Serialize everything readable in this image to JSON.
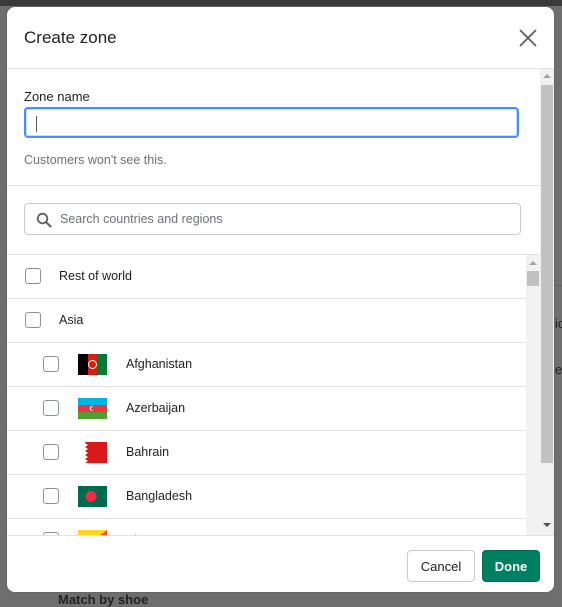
{
  "background": {
    "partial_texts": [
      "ic",
      "e",
      "Match by shoe"
    ]
  },
  "modal": {
    "title": "Create zone",
    "close_label": "Close"
  },
  "form": {
    "zone_name_label": "Zone name",
    "zone_name_value": "",
    "zone_name_help": "Customers won't see this.",
    "search_placeholder": "Search countries and regions"
  },
  "list": {
    "items": [
      {
        "label": "Rest of world",
        "level": 0,
        "checked": false
      },
      {
        "label": "Asia",
        "level": 0,
        "checked": false
      },
      {
        "label": "Afghanistan",
        "level": 1,
        "checked": false,
        "flag": "af"
      },
      {
        "label": "Azerbaijan",
        "level": 1,
        "checked": false,
        "flag": "az"
      },
      {
        "label": "Bahrain",
        "level": 1,
        "checked": false,
        "flag": "bh"
      },
      {
        "label": "Bangladesh",
        "level": 1,
        "checked": false,
        "flag": "bd"
      },
      {
        "label": "Bhutan",
        "level": 1,
        "checked": false,
        "flag": "bt"
      }
    ]
  },
  "footer": {
    "cancel_label": "Cancel",
    "done_label": "Done"
  },
  "colors": {
    "primary": "#008060",
    "focus": "#458fff"
  }
}
